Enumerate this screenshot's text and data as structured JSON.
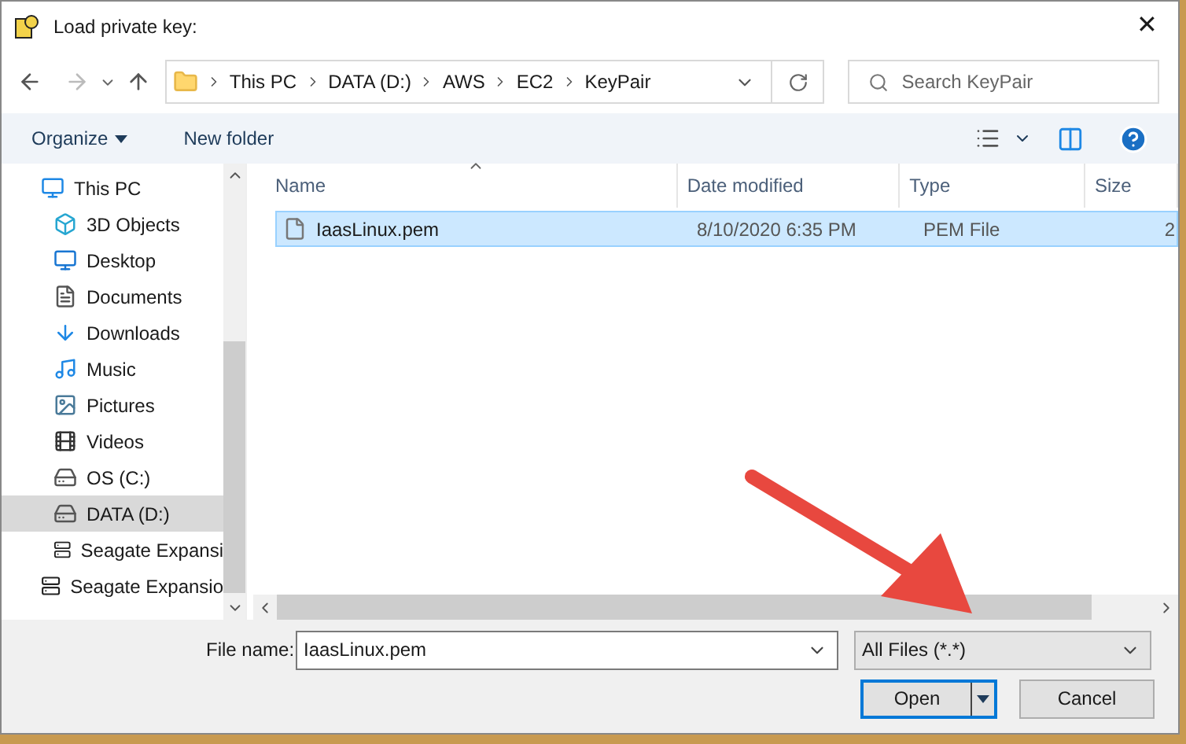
{
  "window": {
    "title": "Load private key:",
    "close": "✕"
  },
  "nav": {
    "breadcrumb": [
      "This PC",
      "DATA (D:)",
      "AWS",
      "EC2",
      "KeyPair"
    ],
    "search_placeholder": "Search KeyPair"
  },
  "toolbar": {
    "organize": "Organize",
    "new_folder": "New folder"
  },
  "sidebar": {
    "items": [
      {
        "label": "This PC",
        "selected": false
      },
      {
        "label": "3D Objects",
        "selected": false
      },
      {
        "label": "Desktop",
        "selected": false
      },
      {
        "label": "Documents",
        "selected": false
      },
      {
        "label": "Downloads",
        "selected": false
      },
      {
        "label": "Music",
        "selected": false
      },
      {
        "label": "Pictures",
        "selected": false
      },
      {
        "label": "Videos",
        "selected": false
      },
      {
        "label": "OS (C:)",
        "selected": false
      },
      {
        "label": "DATA (D:)",
        "selected": true
      },
      {
        "label": "Seagate Expansi",
        "selected": false
      },
      {
        "label": "Seagate Expansio",
        "selected": false
      }
    ]
  },
  "table": {
    "columns": [
      "Name",
      "Date modified",
      "Type",
      "Size"
    ],
    "rows": [
      {
        "name": "IaasLinux.pem",
        "date": "8/10/2020 6:35 PM",
        "type": "PEM File",
        "size": "2",
        "selected": true
      }
    ]
  },
  "footer": {
    "file_name_label": "File name:",
    "file_name_value": "IaasLinux.pem",
    "filter": "All Files (*.*)",
    "open": "Open",
    "cancel": "Cancel"
  }
}
